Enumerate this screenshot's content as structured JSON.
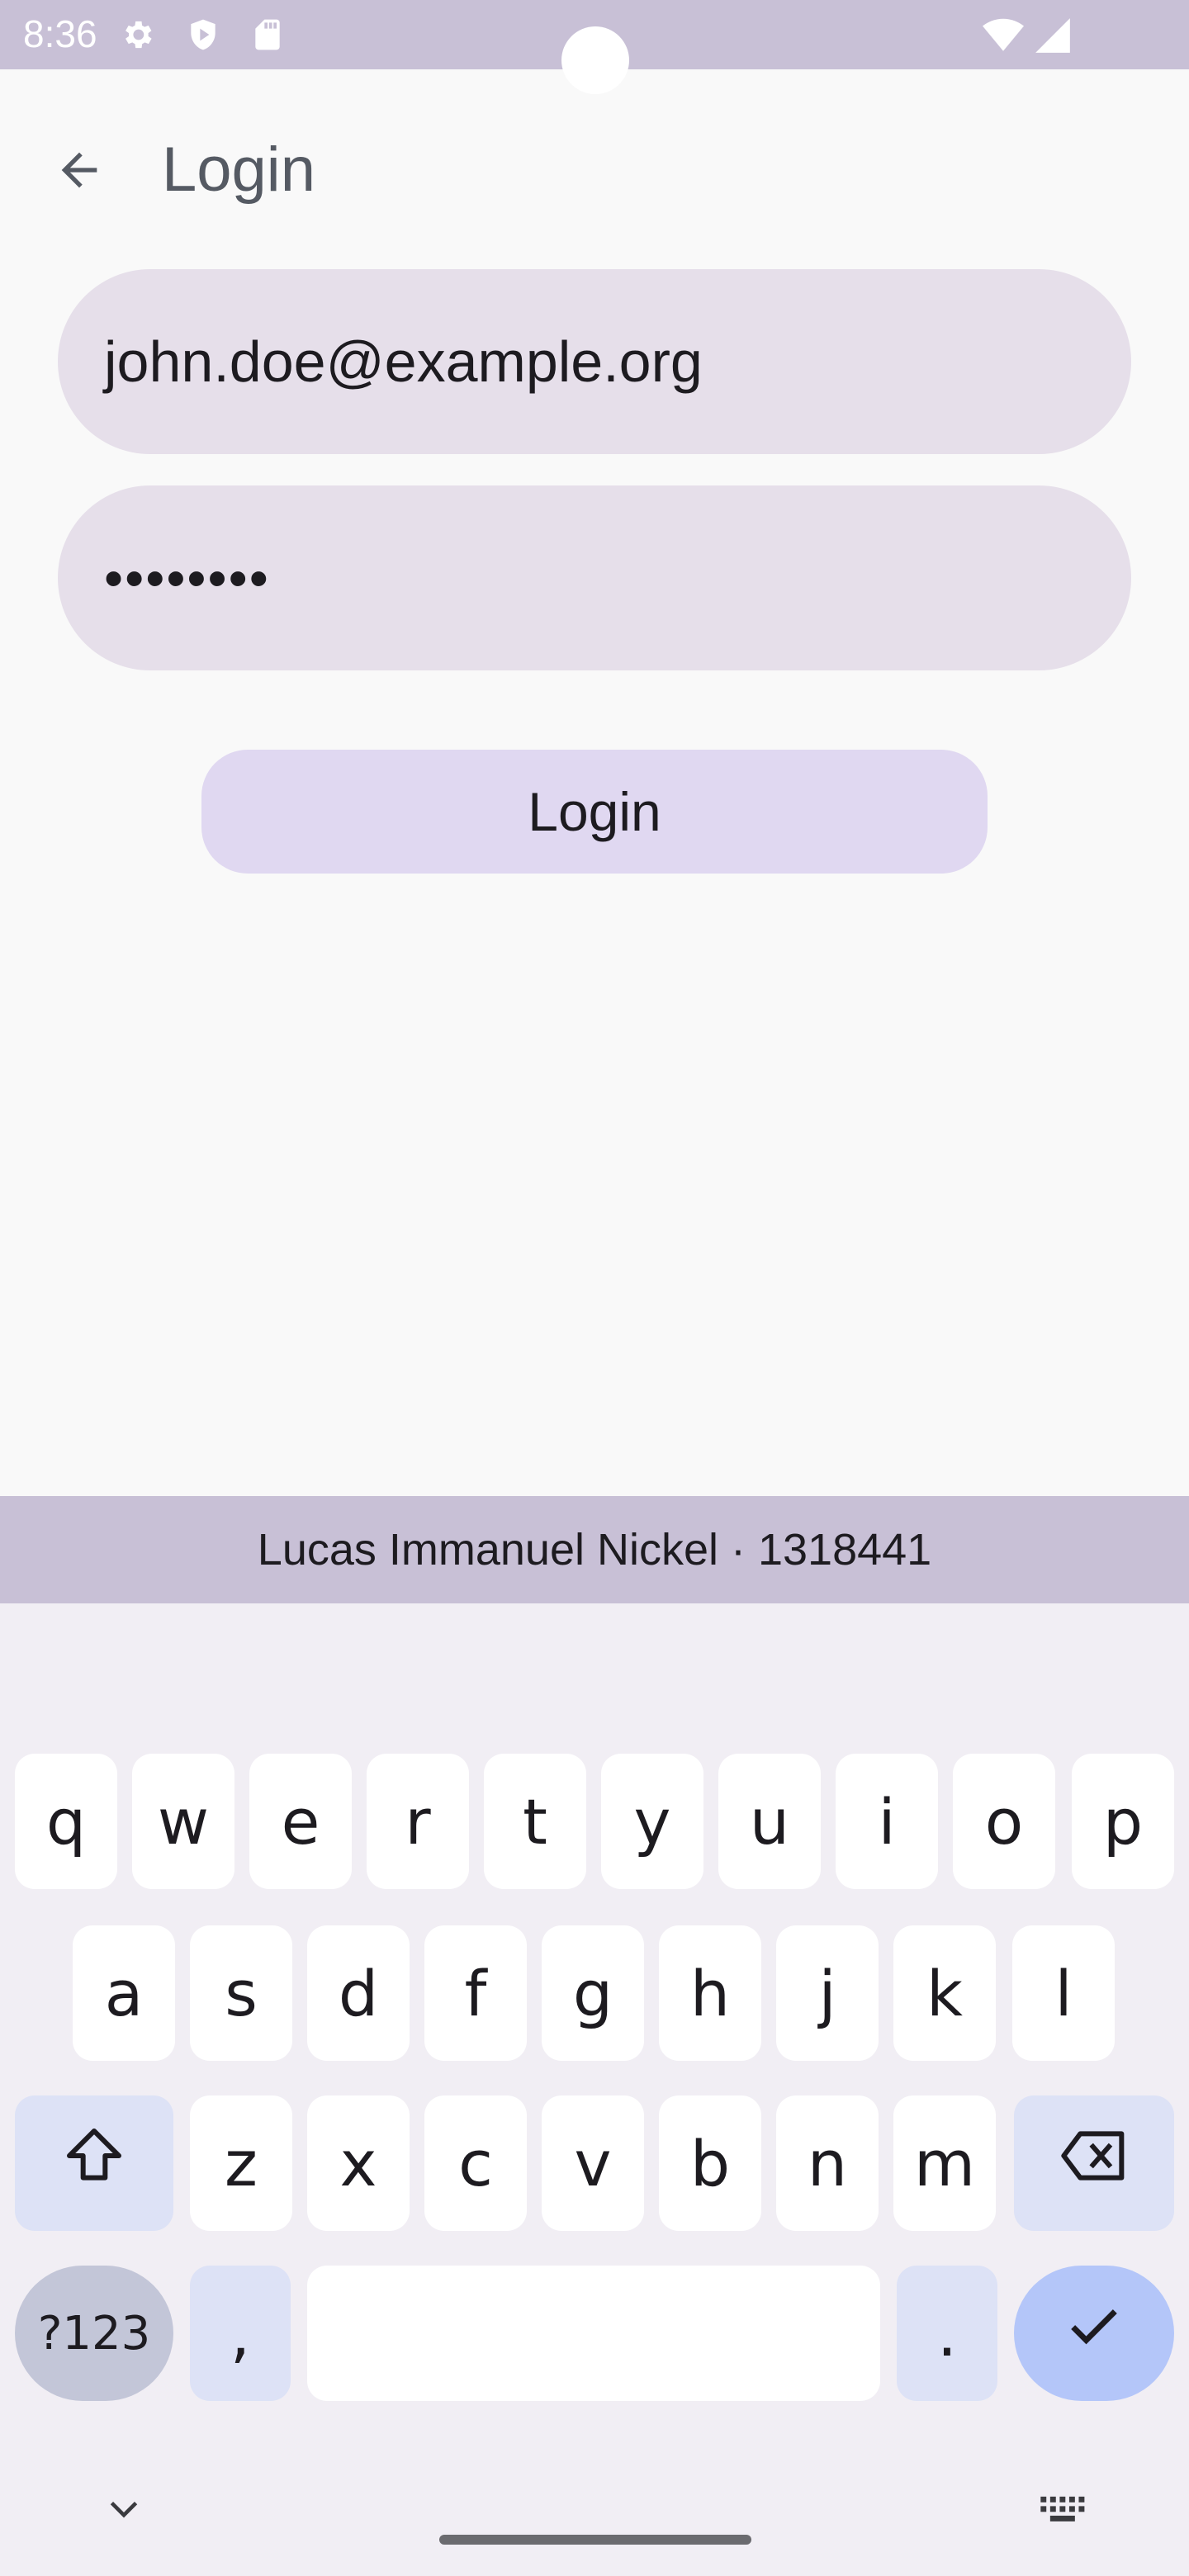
{
  "status_bar": {
    "time": "8:36",
    "left_icons": [
      "gear-icon",
      "shield-play-icon",
      "sd-card-icon"
    ],
    "right_icons": [
      "wifi-icon",
      "signal-icon"
    ]
  },
  "app_bar": {
    "back_icon": "arrow-left-icon",
    "title": "Login"
  },
  "form": {
    "email_value": "john.doe@example.org",
    "password_value": "••••••••",
    "login_button_label": "Login"
  },
  "banner": {
    "text": "Lucas Immanuel Nickel · 1318441"
  },
  "keyboard": {
    "row1": [
      "q",
      "w",
      "e",
      "r",
      "t",
      "y",
      "u",
      "i",
      "o",
      "p"
    ],
    "row2": [
      "a",
      "s",
      "d",
      "f",
      "g",
      "h",
      "j",
      "k",
      "l"
    ],
    "row3": [
      "z",
      "x",
      "c",
      "v",
      "b",
      "n",
      "m"
    ],
    "symbols_label": "?123",
    "comma_label": ",",
    "period_label": ".",
    "shift_icon": "shift-arrow-icon",
    "backspace_icon": "backspace-icon",
    "enter_icon": "checkmark-icon",
    "collapse_icon": "chevron-down-icon",
    "switch_keyboard_icon": "keyboard-icon"
  },
  "colors": {
    "status_bar": "#c8c0d6",
    "field_background": "#e6dfea",
    "button_background": "#e0d8f1",
    "keyboard_background": "#f1eef4",
    "modifier_key": "#dde2f6",
    "enter_key": "#b4c6f9"
  }
}
